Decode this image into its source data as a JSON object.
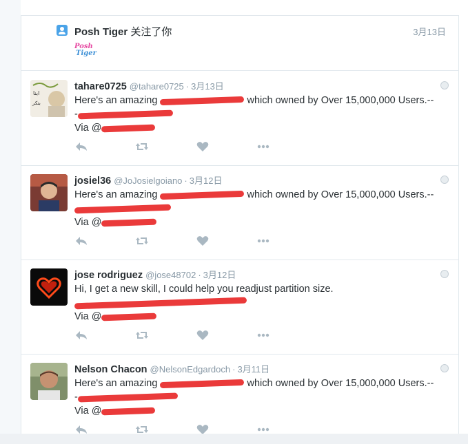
{
  "notification": {
    "name": "Posh Tiger",
    "action": "关注了你",
    "time": "3月13日",
    "logo_line1": "Posh",
    "logo_line2": "Tiger"
  },
  "tweets": [
    {
      "fullname": "tahare0725",
      "handle": "@tahare0725",
      "separator": "·",
      "date": "3月13日",
      "line1_start": "Here's an amazing",
      "line1_end": "which owned by Over 15,000,000 Users.--",
      "line2_start": "-",
      "line3_start": "Via @"
    },
    {
      "fullname": "josiel36",
      "handle": "@JoJosielgoiano",
      "separator": "·",
      "date": "3月12日",
      "line1_start": "Here's an amazing",
      "line1_end": "which owned by Over 15,000,000 Users.--",
      "line2_start": "",
      "line3_start": "Via @"
    },
    {
      "fullname": "jose rodriguez",
      "handle": "@jose48702",
      "separator": "·",
      "date": "3月12日",
      "line1_start": "Hi, I get a new skill, I could help you readjust  partition size.",
      "line1_end": "",
      "line2_start": "",
      "line3_start": "Via @"
    },
    {
      "fullname": "Nelson Chacon",
      "handle": "@NelsonEdgardoch",
      "separator": "·",
      "date": "3月11日",
      "line1_start": "Here's an amazing",
      "line1_end": "which owned by Over 15,000,000 Users.--",
      "line2_start": "-",
      "line3_start": "Via @"
    }
  ],
  "icons": {
    "reply": "reply-icon",
    "retweet": "retweet-icon",
    "like": "heart-icon",
    "more": "more-dots-icon"
  },
  "colors": {
    "redaction": "#ea3a3a",
    "muted": "#8899a6",
    "icon": "#aab8c2",
    "follow_icon": "#4aa3e8"
  }
}
